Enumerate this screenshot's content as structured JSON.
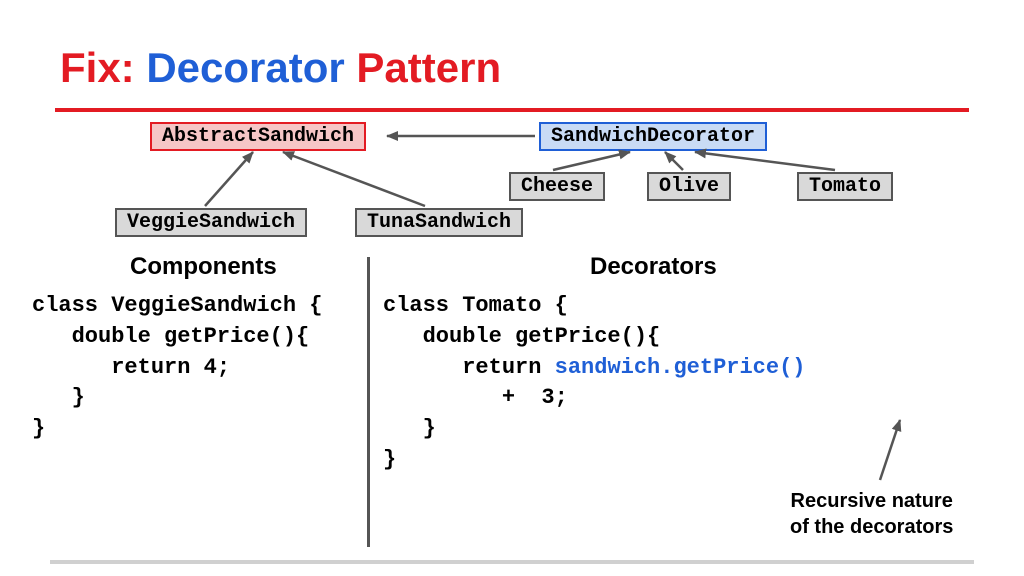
{
  "title": {
    "prefix": "Fix:",
    "mid": "Decorator",
    "suffix": "Pattern"
  },
  "classes": {
    "abstract": "AbstractSandwich",
    "decoratorBase": "SandwichDecorator",
    "veggie": "VeggieSandwich",
    "tuna": "TunaSandwich",
    "cheese": "Cheese",
    "olive": "Olive",
    "tomato": "Tomato"
  },
  "sections": {
    "components": "Components",
    "decorators": "Decorators"
  },
  "code": {
    "veggie": "class VeggieSandwich {\n   double getPrice(){\n      return 4;\n   }\n}",
    "tomato_pre": "class Tomato {\n   double getPrice(){\n      return ",
    "tomato_call": "sandwich.getPrice()",
    "tomato_post": "\n         +  3;\n   }\n}"
  },
  "annotation": {
    "line1": "Recursive nature",
    "line2": "of the decorators"
  }
}
